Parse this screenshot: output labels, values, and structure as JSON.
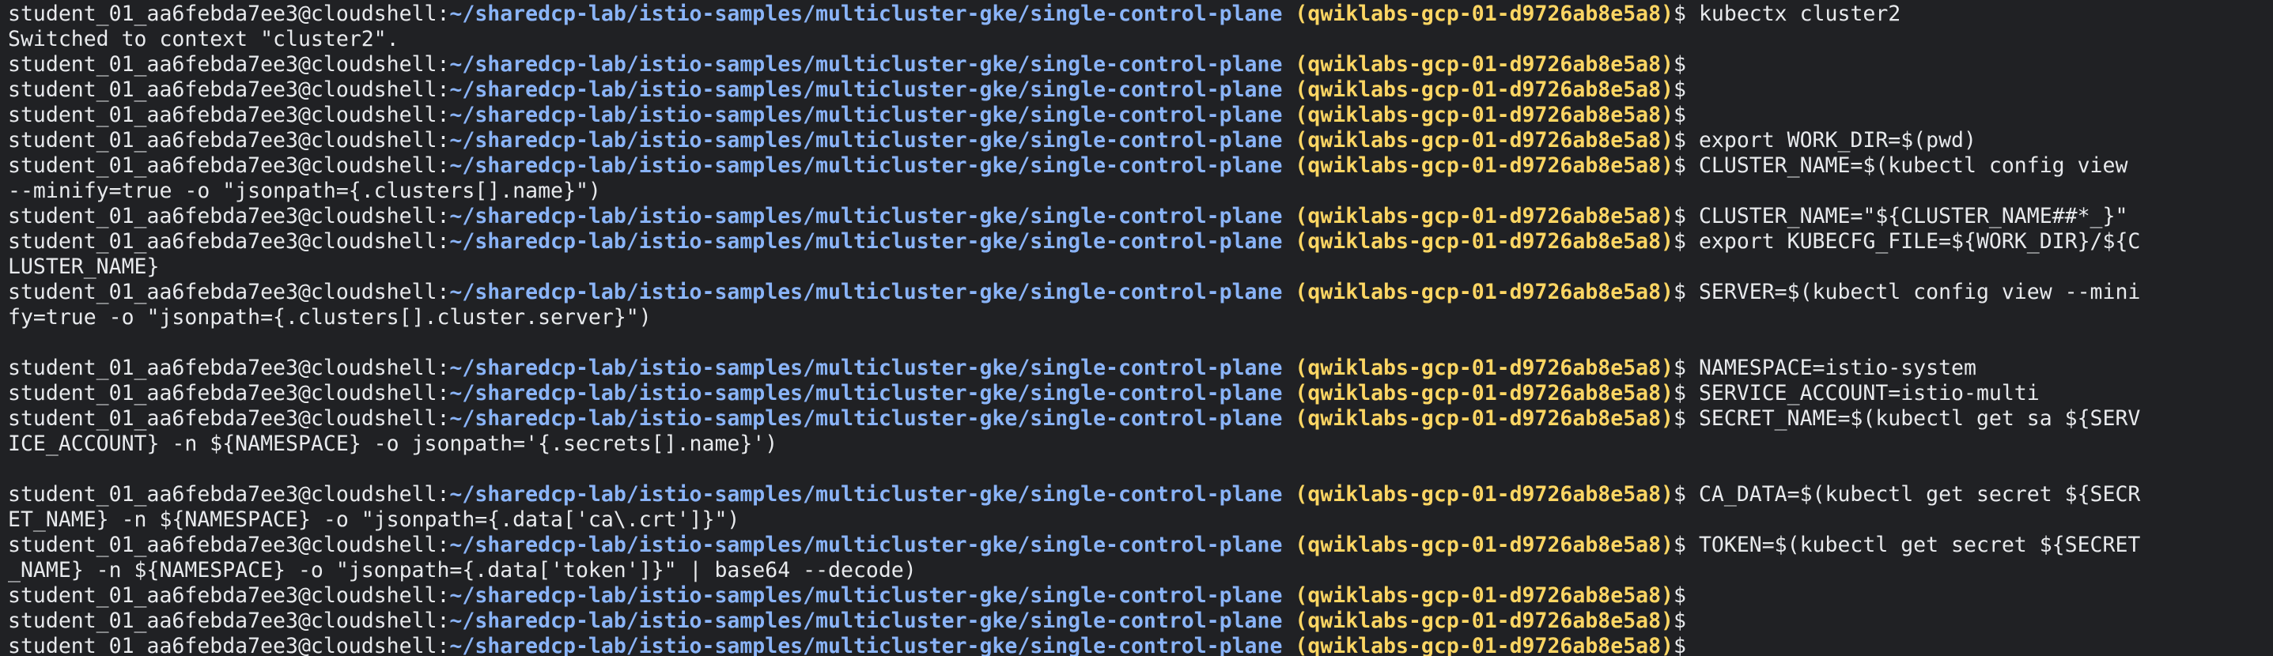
{
  "terminal": {
    "user_host": "student_01_aa6febda7ee3@cloudshell:",
    "cwd": "~/sharedcp-lab/istio-samples/multicluster-gke/single-control-plane",
    "project": "(qwiklabs-gcp-01-d9726ab8e5a8)",
    "prompt_symbol": "$",
    "lines": [
      {
        "kind": "prompt",
        "cmd": "kubectx cluster2"
      },
      {
        "kind": "output",
        "text": "Switched to context \"cluster2\"."
      },
      {
        "kind": "prompt",
        "cmd": ""
      },
      {
        "kind": "prompt",
        "cmd": ""
      },
      {
        "kind": "prompt",
        "cmd": ""
      },
      {
        "kind": "prompt",
        "cmd": "export WORK_DIR=$(pwd)"
      },
      {
        "kind": "prompt",
        "cmd": "CLUSTER_NAME=$(kubectl config view"
      },
      {
        "kind": "output",
        "text": "--minify=true -o \"jsonpath={.clusters[].name}\")"
      },
      {
        "kind": "prompt",
        "cmd": "CLUSTER_NAME=\"${CLUSTER_NAME##*_}\""
      },
      {
        "kind": "prompt",
        "cmd": "export KUBECFG_FILE=${WORK_DIR}/${C"
      },
      {
        "kind": "output",
        "text": "LUSTER_NAME}"
      },
      {
        "kind": "prompt",
        "cmd": "SERVER=$(kubectl config view --mini"
      },
      {
        "kind": "output",
        "text": "fy=true -o \"jsonpath={.clusters[].cluster.server}\")"
      },
      {
        "kind": "blank"
      },
      {
        "kind": "prompt",
        "cmd": "NAMESPACE=istio-system"
      },
      {
        "kind": "prompt",
        "cmd": "SERVICE_ACCOUNT=istio-multi"
      },
      {
        "kind": "prompt",
        "cmd": "SECRET_NAME=$(kubectl get sa ${SERV"
      },
      {
        "kind": "output",
        "text": "ICE_ACCOUNT} -n ${NAMESPACE} -o jsonpath='{.secrets[].name}')"
      },
      {
        "kind": "blank"
      },
      {
        "kind": "prompt",
        "cmd": "CA_DATA=$(kubectl get secret ${SECR"
      },
      {
        "kind": "output",
        "text": "ET_NAME} -n ${NAMESPACE} -o \"jsonpath={.data['ca\\.crt']}\")"
      },
      {
        "kind": "prompt",
        "cmd": "TOKEN=$(kubectl get secret ${SECRET"
      },
      {
        "kind": "output",
        "text": "_NAME} -n ${NAMESPACE} -o \"jsonpath={.data['token']}\" | base64 --decode)"
      },
      {
        "kind": "prompt",
        "cmd": ""
      },
      {
        "kind": "prompt",
        "cmd": ""
      },
      {
        "kind": "prompt",
        "cmd": ""
      }
    ],
    "colors": {
      "background": "#202124",
      "text": "#e8eaed",
      "path": "#8ab4f8",
      "project": "#fdd663"
    }
  }
}
